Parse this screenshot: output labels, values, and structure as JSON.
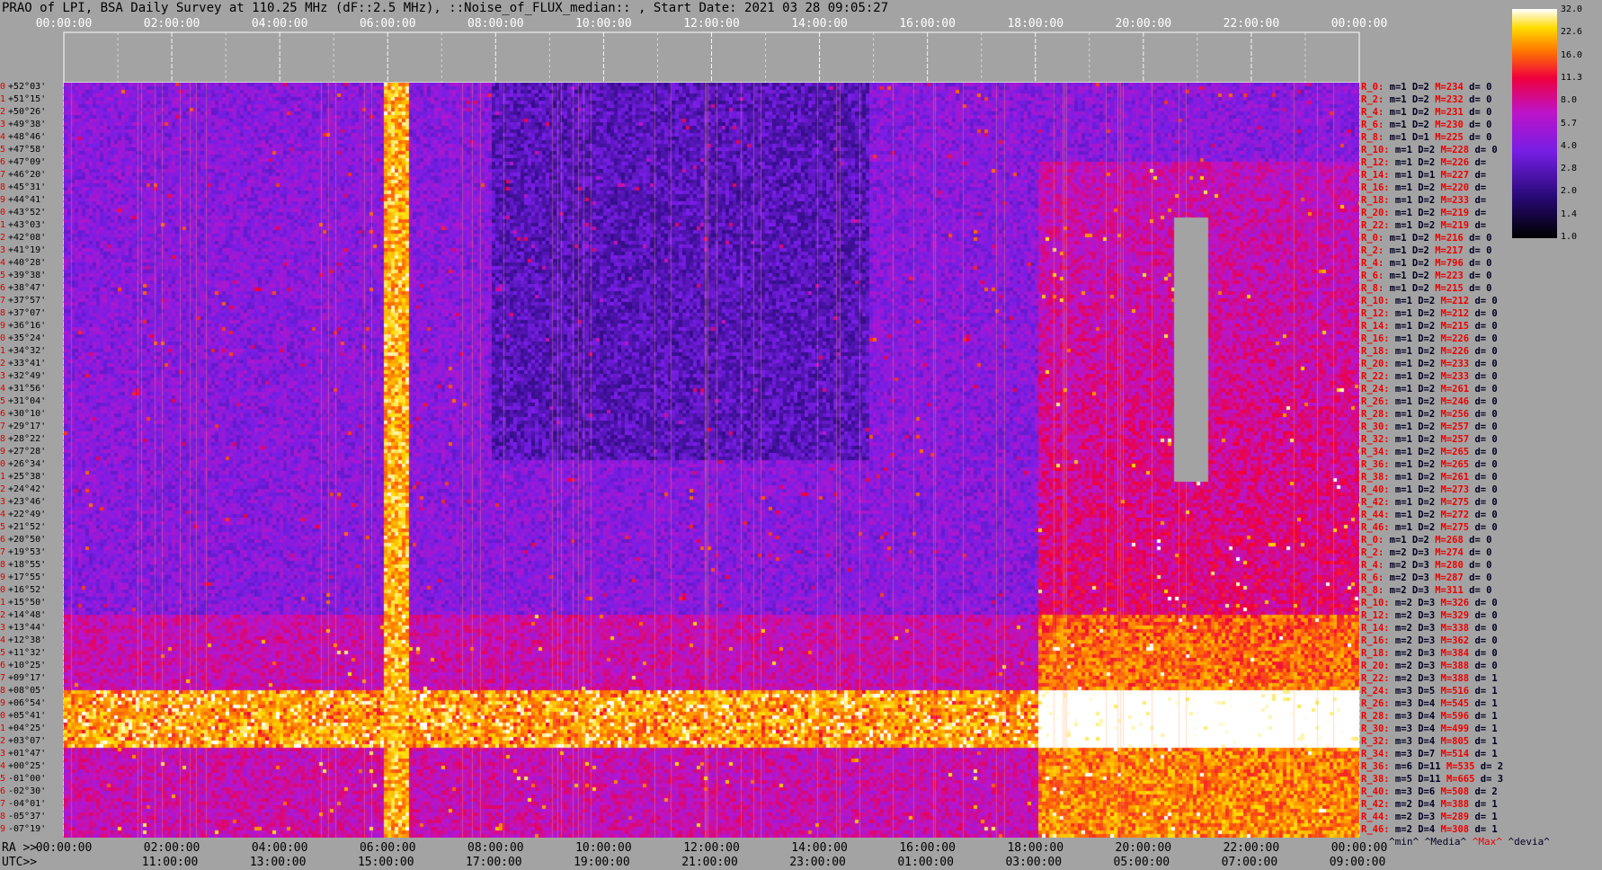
{
  "title": "PRAO of LPI, BSA Daily Survey at 110.25 MHz (dF::2.5 MHz), ::Noise_of_FLUX_median:: , Start Date: 2021 03 28 09:05:27",
  "chart_data": {
    "type": "heatmap",
    "ra_ticks": [
      "00:00:00",
      "02:00:00",
      "04:00:00",
      "06:00:00",
      "08:00:00",
      "10:00:00",
      "12:00:00",
      "14:00:00",
      "16:00:00",
      "18:00:00",
      "20:00:00",
      "22:00:00",
      "00:00:00"
    ],
    "utc_ticks": [
      "11:00:00",
      "13:00:00",
      "15:00:00",
      "17:00:00",
      "19:00:00",
      "21:00:00",
      "23:00:00",
      "01:00:00",
      "03:00:00",
      "05:00:00",
      "07:00:00",
      "09:00:00"
    ],
    "declinations": [
      "+52°03'",
      "+51°15'",
      "+50°26'",
      "+49°38'",
      "+48°46'",
      "+47°58'",
      "+47°09'",
      "+46°20'",
      "+45°31'",
      "+44°41'",
      "+43°52'",
      "+43°03'",
      "+42°08'",
      "+41°19'",
      "+40°28'",
      "+39°38'",
      "+38°47'",
      "+37°57'",
      "+37°07'",
      "+36°16'",
      "+35°24'",
      "+34°32'",
      "+33°41'",
      "+32°49'",
      "+31°56'",
      "+31°04'",
      "+30°10'",
      "+29°17'",
      "+28°22'",
      "+27°28'",
      "+26°34'",
      "+25°38'",
      "+24°42'",
      "+23°46'",
      "+22°49'",
      "+21°52'",
      "+20°50'",
      "+19°53'",
      "+18°55'",
      "+17°55'",
      "+16°52'",
      "+15°50'",
      "+14°48'",
      "+13°44'",
      "+12°38'",
      "+11°32'",
      "+10°25'",
      "+09°17'",
      "+08°05'",
      "+06°54'",
      "+05°41'",
      "+04°25'",
      "+03°07'",
      "+01°47'",
      "+00°25'",
      "-01°00'",
      "-02°30'",
      "-04°01'",
      "-05°37'",
      "-07°19'"
    ],
    "colorbar": [
      "32.0",
      "22.6",
      "16.0",
      "11.3",
      "8.0",
      "5.7",
      "4.0",
      "2.8",
      "2.0",
      "1.4",
      "1.0"
    ],
    "ra_label": "RA >>",
    "utc_label": "UTC>>"
  },
  "rows": [
    {
      "lab": "R_0:",
      "m": "1",
      "D": "2",
      "M": "234",
      "d": "0"
    },
    {
      "lab": "R_2:",
      "m": "1",
      "D": "2",
      "M": "232",
      "d": "0"
    },
    {
      "lab": "R_4:",
      "m": "1",
      "D": "2",
      "M": "231",
      "d": "0"
    },
    {
      "lab": "R_6:",
      "m": "1",
      "D": "2",
      "M": "230",
      "d": "0"
    },
    {
      "lab": "R_8:",
      "m": "1",
      "D": "1",
      "M": "225",
      "d": "0"
    },
    {
      "lab": "R_10:",
      "m": "1",
      "D": "2",
      "M": "228",
      "d": "0"
    },
    {
      "lab": "R_12:",
      "m": "1",
      "D": "2",
      "M": "226",
      "d": ""
    },
    {
      "lab": "R_14:",
      "m": "1",
      "D": "1",
      "M": "227",
      "d": ""
    },
    {
      "lab": "R_16:",
      "m": "1",
      "D": "2",
      "M": "220",
      "d": ""
    },
    {
      "lab": "R_18:",
      "m": "1",
      "D": "2",
      "M": "233",
      "d": ""
    },
    {
      "lab": "R_20:",
      "m": "1",
      "D": "2",
      "M": "219",
      "d": ""
    },
    {
      "lab": "R_22:",
      "m": "1",
      "D": "2",
      "M": "219",
      "d": ""
    },
    {
      "lab": "R_0:",
      "m": "1",
      "D": "2",
      "M": "216",
      "d": "0"
    },
    {
      "lab": "R_2:",
      "m": "1",
      "D": "2",
      "M": "217",
      "d": "0"
    },
    {
      "lab": "R_4:",
      "m": "1",
      "D": "2",
      "M": "796",
      "d": "0"
    },
    {
      "lab": "R_6:",
      "m": "1",
      "D": "2",
      "M": "223",
      "d": "0"
    },
    {
      "lab": "R_8:",
      "m": "1",
      "D": "2",
      "M": "215",
      "d": "0"
    },
    {
      "lab": "R_10:",
      "m": "1",
      "D": "2",
      "M": "212",
      "d": "0"
    },
    {
      "lab": "R_12:",
      "m": "1",
      "D": "2",
      "M": "212",
      "d": "0"
    },
    {
      "lab": "R_14:",
      "m": "1",
      "D": "2",
      "M": "215",
      "d": "0"
    },
    {
      "lab": "R_16:",
      "m": "1",
      "D": "2",
      "M": "226",
      "d": "0"
    },
    {
      "lab": "R_18:",
      "m": "1",
      "D": "2",
      "M": "226",
      "d": "0"
    },
    {
      "lab": "R_20:",
      "m": "1",
      "D": "2",
      "M": "233",
      "d": "0"
    },
    {
      "lab": "R_22:",
      "m": "1",
      "D": "2",
      "M": "233",
      "d": "0"
    },
    {
      "lab": "R_24:",
      "m": "1",
      "D": "2",
      "M": "261",
      "d": "0"
    },
    {
      "lab": "R_26:",
      "m": "1",
      "D": "2",
      "M": "246",
      "d": "0"
    },
    {
      "lab": "R_28:",
      "m": "1",
      "D": "2",
      "M": "256",
      "d": "0"
    },
    {
      "lab": "R_30:",
      "m": "1",
      "D": "2",
      "M": "257",
      "d": "0"
    },
    {
      "lab": "R_32:",
      "m": "1",
      "D": "2",
      "M": "257",
      "d": "0"
    },
    {
      "lab": "R_34:",
      "m": "1",
      "D": "2",
      "M": "265",
      "d": "0"
    },
    {
      "lab": "R_36:",
      "m": "1",
      "D": "2",
      "M": "265",
      "d": "0"
    },
    {
      "lab": "R_38:",
      "m": "1",
      "D": "2",
      "M": "261",
      "d": "0"
    },
    {
      "lab": "R_40:",
      "m": "1",
      "D": "2",
      "M": "273",
      "d": "0"
    },
    {
      "lab": "R_42:",
      "m": "1",
      "D": "2",
      "M": "275",
      "d": "0"
    },
    {
      "lab": "R_44:",
      "m": "1",
      "D": "2",
      "M": "272",
      "d": "0"
    },
    {
      "lab": "R_46:",
      "m": "1",
      "D": "2",
      "M": "275",
      "d": "0"
    },
    {
      "lab": "R_0:",
      "m": "1",
      "D": "2",
      "M": "268",
      "d": "0"
    },
    {
      "lab": "R_2:",
      "m": "2",
      "D": "3",
      "M": "274",
      "d": "0"
    },
    {
      "lab": "R_4:",
      "m": "2",
      "D": "3",
      "M": "280",
      "d": "0"
    },
    {
      "lab": "R_6:",
      "m": "2",
      "D": "3",
      "M": "287",
      "d": "0"
    },
    {
      "lab": "R_8:",
      "m": "2",
      "D": "3",
      "M": "311",
      "d": "0"
    },
    {
      "lab": "R_10:",
      "m": "2",
      "D": "3",
      "M": "326",
      "d": "0"
    },
    {
      "lab": "R_12:",
      "m": "2",
      "D": "3",
      "M": "329",
      "d": "0"
    },
    {
      "lab": "R_14:",
      "m": "2",
      "D": "3",
      "M": "338",
      "d": "0"
    },
    {
      "lab": "R_16:",
      "m": "2",
      "D": "3",
      "M": "362",
      "d": "0"
    },
    {
      "lab": "R_18:",
      "m": "2",
      "D": "3",
      "M": "384",
      "d": "0"
    },
    {
      "lab": "R_20:",
      "m": "2",
      "D": "3",
      "M": "388",
      "d": "0"
    },
    {
      "lab": "R_22:",
      "m": "2",
      "D": "3",
      "M": "388",
      "d": "1"
    },
    {
      "lab": "R_24:",
      "m": "3",
      "D": "5",
      "M": "516",
      "d": "1"
    },
    {
      "lab": "R_26:",
      "m": "3",
      "D": "4",
      "M": "545",
      "d": "1"
    },
    {
      "lab": "R_28:",
      "m": "3",
      "D": "4",
      "M": "596",
      "d": "1"
    },
    {
      "lab": "R_30:",
      "m": "3",
      "D": "4",
      "M": "499",
      "d": "1"
    },
    {
      "lab": "R_32:",
      "m": "3",
      "D": "4",
      "M": "805",
      "d": "1"
    },
    {
      "lab": "R_34:",
      "m": "3",
      "D": "7",
      "M": "514",
      "d": "1"
    },
    {
      "lab": "R_36:",
      "m": "6",
      "D": "11",
      "M": "535",
      "d": "2"
    },
    {
      "lab": "R_38:",
      "m": "5",
      "D": "11",
      "M": "665",
      "d": "3"
    },
    {
      "lab": "R_40:",
      "m": "3",
      "D": "6",
      "M": "508",
      "d": "2"
    },
    {
      "lab": "R_42:",
      "m": "2",
      "D": "4",
      "M": "388",
      "d": "1"
    },
    {
      "lab": "R_44:",
      "m": "2",
      "D": "3",
      "M": "289",
      "d": "1"
    },
    {
      "lab": "R_46:",
      "m": "2",
      "D": "4",
      "M": "308",
      "d": "1"
    }
  ],
  "footer": {
    "min": "^min^",
    "median": "^Media^",
    "max": "^Max^",
    "dev": "^devia^"
  }
}
